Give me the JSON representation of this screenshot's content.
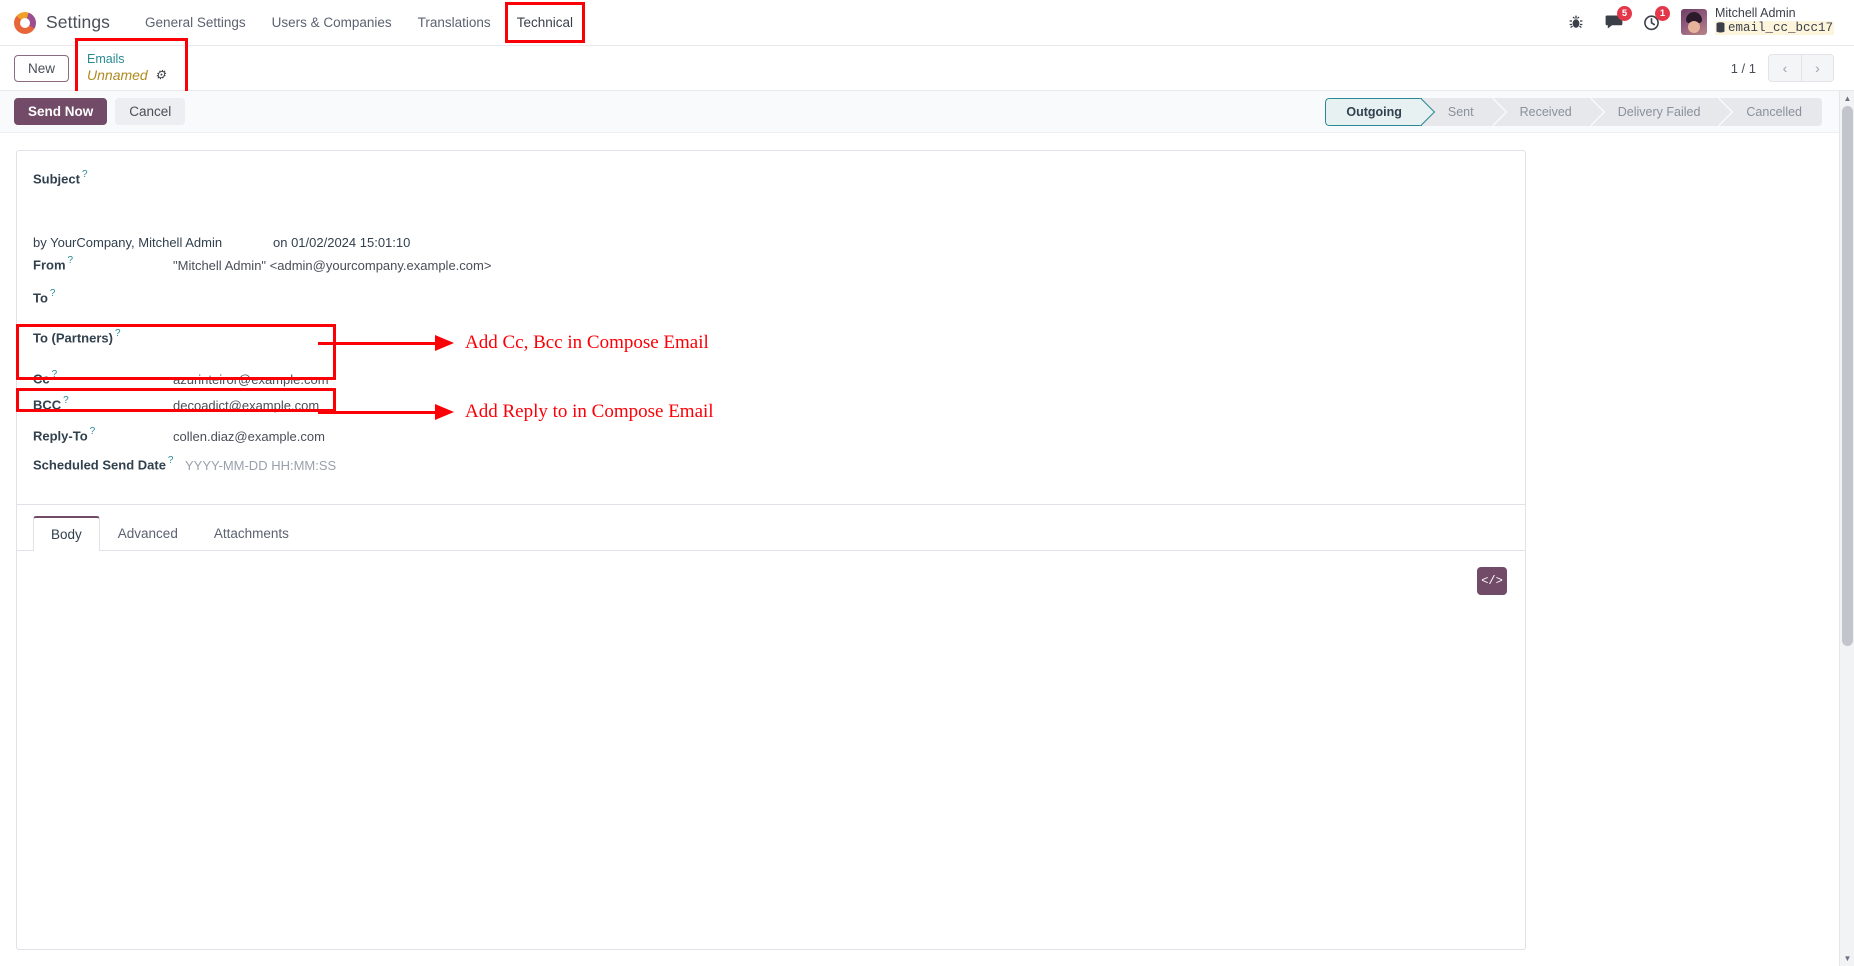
{
  "navbar": {
    "logo_icon": "odoo-logo-icon",
    "app_name": "Settings",
    "menu_items": [
      {
        "label": "General Settings",
        "boxed": false
      },
      {
        "label": "Users & Companies",
        "boxed": false
      },
      {
        "label": "Translations",
        "boxed": false
      },
      {
        "label": "Technical",
        "boxed": true
      }
    ],
    "icons": [
      {
        "name": "bug-icon",
        "badge": null
      },
      {
        "name": "messages-icon",
        "badge": "5"
      },
      {
        "name": "activities-clock-icon",
        "badge": "1"
      }
    ],
    "user": {
      "name": "Mitchell Admin",
      "database": "email_cc_bcc17",
      "database_icon": "database-icon",
      "avatar_icon": "user-avatar"
    }
  },
  "control_panel": {
    "new_button": "New",
    "breadcrumb_parent": "Emails",
    "breadcrumb_current": "Unnamed",
    "gear_icon": "gear-icon",
    "pager_count": "1 / 1",
    "prev_icon": "chevron-left-icon",
    "next_icon": "chevron-right-icon"
  },
  "actions": {
    "send_now": "Send Now",
    "cancel": "Cancel"
  },
  "statusbar": {
    "stages": [
      "Outgoing",
      "Sent",
      "Received",
      "Delivery Failed",
      "Cancelled"
    ],
    "active": "Outgoing",
    "active_color": "#2a8a94"
  },
  "form": {
    "subject": {
      "label": "Subject",
      "value": "",
      "help_icon": "help-icon"
    },
    "meta": {
      "by": "by YourCompany, Mitchell Admin",
      "on": "on 01/02/2024 15:01:10"
    },
    "fields": [
      {
        "label": "From",
        "value": "\"Mitchell Admin\" <admin@yourcompany.example.com>",
        "placeholder": false
      },
      {
        "label": "To",
        "value": "",
        "placeholder": false
      },
      {
        "label": "To (Partners)",
        "value": "",
        "placeholder": false
      },
      {
        "label": "Cc",
        "value": "azurinteiror@example.com",
        "placeholder": false
      },
      {
        "label": "BCC",
        "value": "decoadict@example.com",
        "placeholder": false
      },
      {
        "label": "Reply-To",
        "value": "collen.diaz@example.com",
        "placeholder": false
      },
      {
        "label": "Scheduled Send Date",
        "value": "YYYY-MM-DD HH:MM:SS",
        "placeholder": true
      }
    ]
  },
  "notebook": {
    "tabs": [
      "Body",
      "Advanced",
      "Attachments"
    ],
    "active": "Body",
    "code_button_icon": "code-view-icon",
    "code_button_label": "</>"
  },
  "annotations": [
    {
      "text": "Add Cc, Bcc in Compose Email",
      "color": "#fb0007"
    },
    {
      "text": "Add Reply to in Compose Email",
      "color": "#fb0007"
    }
  ],
  "scrollbar": {
    "up_icon": "scroll-up-icon",
    "down_icon": "scroll-down-icon",
    "up_glyph": "▲",
    "down_glyph": "▼"
  }
}
